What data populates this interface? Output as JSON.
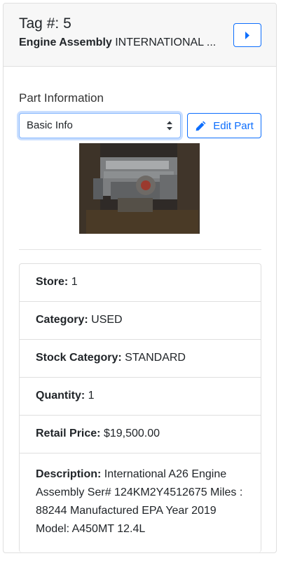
{
  "header": {
    "tag_label": "Tag #:",
    "tag_number": "5",
    "part_type": "Engine Assembly",
    "part_make": "INTERNATIONAL ..."
  },
  "part_info": {
    "section_label": "Part Information",
    "select_value": "Basic Info",
    "edit_button_label": "Edit Part",
    "photo_alt": "engine-photo"
  },
  "details": {
    "store_label": "Store:",
    "store_value": "1",
    "category_label": "Category:",
    "category_value": "USED",
    "stock_category_label": "Stock Category:",
    "stock_category_value": "STANDARD",
    "quantity_label": "Quantity:",
    "quantity_value": "1",
    "retail_price_label": "Retail Price:",
    "retail_price_value": "$19,500.00",
    "description_label": "Description:",
    "description_value": "International A26 Engine Assembly Ser# 124KM2Y4512675 Miles : 88244 Manufactured EPA Year 2019 Model: A450MT 12.4L"
  },
  "colors": {
    "primary": "#0d6efd",
    "header_bg": "#f7f7f7",
    "border": "#dfdfdf"
  },
  "icons": {
    "next": "caret-right-icon",
    "select": "select-arrows-icon",
    "edit": "pencil-icon"
  }
}
